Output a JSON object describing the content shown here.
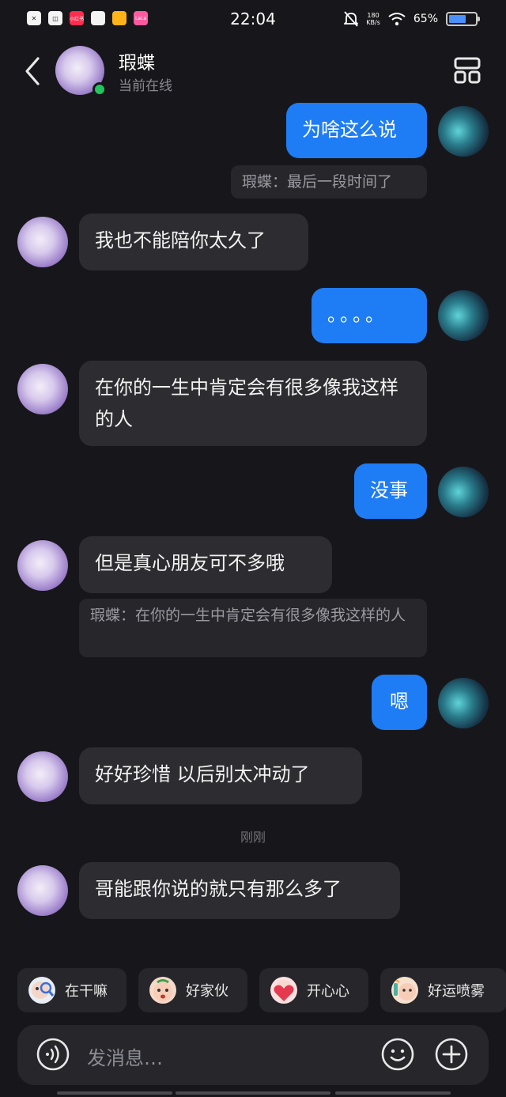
{
  "status_bar": {
    "time": "22:04",
    "net_speed_top": "180",
    "net_speed_bottom": "KB/s",
    "battery_percent": "65%",
    "battery_level": 0.65,
    "app_icons": [
      "x-app",
      "bag-app",
      "小红书",
      "blank-app",
      "meituan-app",
      "LaLa"
    ]
  },
  "header": {
    "contact_name": "瑕蝶",
    "contact_status": "当前在线"
  },
  "messages": [
    {
      "side": "out",
      "text": "为啥这么说"
    },
    {
      "side": "quote",
      "text": "瑕蝶：最后一段时间了"
    },
    {
      "side": "in",
      "text": "我也不能陪你太久了"
    },
    {
      "side": "out",
      "text": "。。。。"
    },
    {
      "side": "in",
      "text": "在你的一生中肯定会有很多像我这样的人"
    },
    {
      "side": "out",
      "text": "没事"
    },
    {
      "side": "in",
      "text": "但是真心朋友可不多哦"
    },
    {
      "side": "quote",
      "text": "瑕蝶：在你的一生中肯定会有很多像我这样的人"
    },
    {
      "side": "out",
      "text": "嗯"
    },
    {
      "side": "in",
      "text": "好好珍惜 以后别太冲动了"
    },
    {
      "side": "time",
      "text": "刚刚"
    },
    {
      "side": "in",
      "text": "哥能跟你说的就只有那么多了"
    }
  ],
  "quick_replies": [
    {
      "label": "在干嘛",
      "icon": "peek-emoji-icon"
    },
    {
      "label": "好家伙",
      "icon": "shocked-emoji-icon"
    },
    {
      "label": "开心心",
      "icon": "heart-emoji-icon"
    },
    {
      "label": "好运喷雾",
      "icon": "spray-emoji-icon"
    }
  ],
  "input": {
    "placeholder": "发消息…"
  },
  "colors": {
    "background": "#17171b",
    "incoming_bubble": "#2c2c31",
    "outgoing_bubble": "#1e7cf5",
    "online_dot": "#22c55e"
  }
}
